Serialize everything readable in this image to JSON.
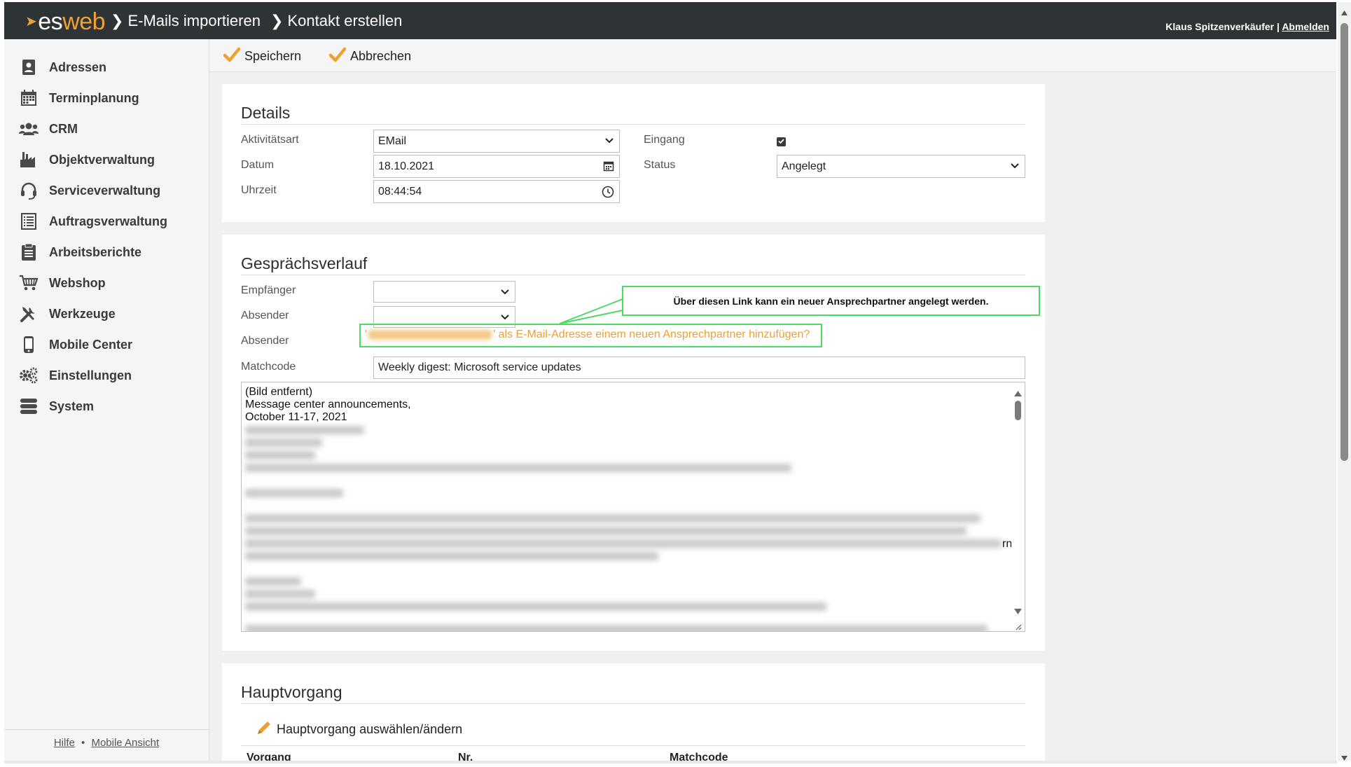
{
  "header": {
    "logo_es": "es",
    "logo_web": "web",
    "breadcrumb": [
      "E-Mails importieren",
      "Kontakt erstellen"
    ],
    "user_name": "Klaus Spitzenverkäufer",
    "separator": "|",
    "logout": "Abmelden"
  },
  "sidebar": {
    "items": [
      {
        "label": "Adressen",
        "icon": "address-book-icon"
      },
      {
        "label": "Terminplanung",
        "icon": "calendar-icon"
      },
      {
        "label": "CRM",
        "icon": "users-icon"
      },
      {
        "label": "Objektverwaltung",
        "icon": "factory-icon"
      },
      {
        "label": "Serviceverwaltung",
        "icon": "headset-icon"
      },
      {
        "label": "Auftragsverwaltung",
        "icon": "list-icon"
      },
      {
        "label": "Arbeitsberichte",
        "icon": "clipboard-icon"
      },
      {
        "label": "Webshop",
        "icon": "cart-icon"
      },
      {
        "label": "Werkzeuge",
        "icon": "tools-icon"
      },
      {
        "label": "Mobile Center",
        "icon": "phone-icon"
      },
      {
        "label": "Einstellungen",
        "icon": "gears-icon"
      },
      {
        "label": "System",
        "icon": "database-icon"
      }
    ],
    "footer": {
      "help": "Hilfe",
      "dot": "•",
      "mobile": "Mobile Ansicht"
    }
  },
  "toolbar": {
    "save": "Speichern",
    "cancel": "Abbrechen"
  },
  "details": {
    "title": "Details",
    "aktivitaetsart_label": "Aktivitätsart",
    "aktivitaetsart_value": "EMail",
    "datum_label": "Datum",
    "datum_value": "18.10.2021",
    "uhrzeit_label": "Uhrzeit",
    "uhrzeit_value": "08:44:54",
    "eingang_label": "Eingang",
    "eingang_checked": true,
    "status_label": "Status",
    "status_value": "Angelegt"
  },
  "gespraech": {
    "title": "Gesprächsverlauf",
    "empfaenger_label": "Empfänger",
    "absender_label": "Absender",
    "absender2_label": "Absender",
    "link_prefix": "'",
    "link_suffix": "' als E-Mail-Adresse einem neuen Ansprechpartner hinzufügen?",
    "callout": "Über diesen Link kann ein neuer Ansprechpartner angelegt werden.",
    "matchcode_label": "Matchcode",
    "matchcode_value": "Weekly digest: Microsoft service updates",
    "body_lines": [
      "(Bild entfernt)",
      "Message center announcements,",
      "October 11-17, 2021"
    ],
    "body_tail": "rn"
  },
  "hauptvorgang": {
    "title": "Hauptvorgang",
    "select_link": "Hauptvorgang auswählen/ändern",
    "columns": [
      "Vorgang",
      "Nr.",
      "Matchcode"
    ]
  },
  "colors": {
    "accent": "#f0a030",
    "header_bg": "#2e3436",
    "highlight": "#4cd964"
  }
}
